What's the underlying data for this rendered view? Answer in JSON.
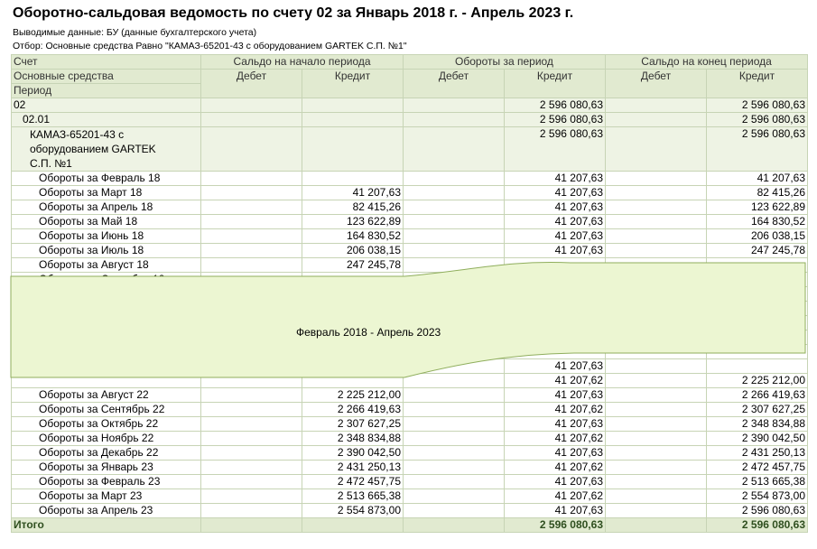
{
  "report": {
    "title": "Оборотно-сальдовая ведомость по счету 02 за Январь 2018 г. - Апрель 2023 г.",
    "output_data": "Выводимые данные: БУ (данные бухгалтерского учета)",
    "filter": "Отбор: Основные средства Равно \"КАМАЗ-65201-43 с оборудованием GARTEK С.П. №1\""
  },
  "table": {
    "col_account": "Счет",
    "col_fixed_assets": "Основные средства",
    "col_period": "Период",
    "group_start": "Сальдо на начало периода",
    "group_turnover": "Обороты за период",
    "group_end": "Сальдо на конец периода",
    "debit": "Дебет",
    "credit": "Кредит",
    "rows": [
      {
        "label": "02",
        "indent": 0,
        "kind": "grp",
        "sd": "",
        "sk": "",
        "od": "",
        "ok": "2 596 080,63",
        "ed": "",
        "ek": "2 596 080,63"
      },
      {
        "label": "02.01",
        "indent": 1,
        "kind": "grp",
        "sd": "",
        "sk": "",
        "od": "",
        "ok": "2 596 080,63",
        "ed": "",
        "ek": "2 596 080,63"
      },
      {
        "label": "КАМАЗ-65201-43 с оборудованием GARTEK С.П. №1",
        "indent": 2,
        "kind": "asset",
        "sd": "",
        "sk": "",
        "od": "",
        "ok": "2 596 080,63",
        "ed": "",
        "ek": "2 596 080,63"
      },
      {
        "label": "Обороты за Февраль 18",
        "indent": 3,
        "sd": "",
        "sk": "",
        "od": "",
        "ok": "41 207,63",
        "ed": "",
        "ek": "41 207,63"
      },
      {
        "label": "Обороты за Март 18",
        "indent": 3,
        "sd": "",
        "sk": "41 207,63",
        "od": "",
        "ok": "41 207,63",
        "ed": "",
        "ek": "82 415,26"
      },
      {
        "label": "Обороты за Апрель 18",
        "indent": 3,
        "sd": "",
        "sk": "82 415,26",
        "od": "",
        "ok": "41 207,63",
        "ed": "",
        "ek": "123 622,89"
      },
      {
        "label": "Обороты за Май 18",
        "indent": 3,
        "sd": "",
        "sk": "123 622,89",
        "od": "",
        "ok": "41 207,63",
        "ed": "",
        "ek": "164 830,52"
      },
      {
        "label": "Обороты за Июнь 18",
        "indent": 3,
        "sd": "",
        "sk": "164 830,52",
        "od": "",
        "ok": "41 207,63",
        "ed": "",
        "ek": "206 038,15"
      },
      {
        "label": "Обороты за Июль 18",
        "indent": 3,
        "sd": "",
        "sk": "206 038,15",
        "od": "",
        "ok": "41 207,63",
        "ed": "",
        "ek": "247 245,78"
      },
      {
        "label": "Обороты за Август 18",
        "indent": 3,
        "sd": "",
        "sk": "247 245,78",
        "od": "",
        "ok": "",
        "ed": "",
        "ek": ""
      },
      {
        "label": "Обороты за Сентябрь 18",
        "indent": 3,
        "sd": "",
        "sk": "",
        "od": "",
        "ok": "",
        "ed": "",
        "ek": ""
      },
      {
        "label": "",
        "indent": 3,
        "sd": "",
        "sk": "",
        "od": "",
        "ok": "",
        "ed": "",
        "ek": ""
      },
      {
        "label": "",
        "indent": 3,
        "sd": "",
        "sk": "",
        "od": "",
        "ok": "",
        "ed": "",
        "ek": ""
      },
      {
        "label": "",
        "indent": 3,
        "sd": "",
        "sk": "",
        "od": "",
        "ok": "",
        "ed": "",
        "ek": ""
      },
      {
        "label": "",
        "indent": 3,
        "sd": "",
        "sk": "",
        "od": "",
        "ok": "",
        "ed": "",
        "ek": ""
      },
      {
        "label": "",
        "indent": 3,
        "sd": "",
        "sk": "",
        "od": "",
        "ok": "",
        "ed": "",
        "ek": ""
      },
      {
        "label": "",
        "indent": 3,
        "sd": "",
        "sk": "",
        "od": "",
        "ok": "41 207,63",
        "ed": "",
        "ek": ""
      },
      {
        "label": "",
        "indent": 3,
        "sd": "",
        "sk": "",
        "od": "",
        "ok": "41 207,62",
        "ed": "",
        "ek": "2 225 212,00"
      },
      {
        "label": "Обороты за Август 22",
        "indent": 3,
        "sd": "",
        "sk": "2 225 212,00",
        "od": "",
        "ok": "41 207,63",
        "ed": "",
        "ek": "2 266 419,63"
      },
      {
        "label": "Обороты за Сентябрь 22",
        "indent": 3,
        "sd": "",
        "sk": "2 266 419,63",
        "od": "",
        "ok": "41 207,62",
        "ed": "",
        "ek": "2 307 627,25"
      },
      {
        "label": "Обороты за Октябрь 22",
        "indent": 3,
        "sd": "",
        "sk": "2 307 627,25",
        "od": "",
        "ok": "41 207,63",
        "ed": "",
        "ek": "2 348 834,88"
      },
      {
        "label": "Обороты за Ноябрь 22",
        "indent": 3,
        "sd": "",
        "sk": "2 348 834,88",
        "od": "",
        "ok": "41 207,62",
        "ed": "",
        "ek": "2 390 042,50"
      },
      {
        "label": "Обороты за Декабрь 22",
        "indent": 3,
        "sd": "",
        "sk": "2 390 042,50",
        "od": "",
        "ok": "41 207,63",
        "ed": "",
        "ek": "2 431 250,13"
      },
      {
        "label": "Обороты за Январь 23",
        "indent": 3,
        "sd": "",
        "sk": "2 431 250,13",
        "od": "",
        "ok": "41 207,62",
        "ed": "",
        "ek": "2 472 457,75"
      },
      {
        "label": "Обороты за Февраль 23",
        "indent": 3,
        "sd": "",
        "sk": "2 472 457,75",
        "od": "",
        "ok": "41 207,63",
        "ed": "",
        "ek": "2 513 665,38"
      },
      {
        "label": "Обороты за Март 23",
        "indent": 3,
        "sd": "",
        "sk": "2 513 665,38",
        "od": "",
        "ok": "41 207,62",
        "ed": "",
        "ek": "2 554 873,00"
      },
      {
        "label": "Обороты за Апрель 23",
        "indent": 3,
        "sd": "",
        "sk": "2 554 873,00",
        "od": "",
        "ok": "41 207,63",
        "ed": "",
        "ek": "2 596 080,63"
      }
    ],
    "total": {
      "label": "Итого",
      "sd": "",
      "sk": "",
      "od": "",
      "ok": "2 596 080,63",
      "ed": "",
      "ek": "2 596 080,63"
    }
  },
  "callout": {
    "text": "Февраль 2018 - Апрель 2023",
    "fill": "#ecf6d2",
    "stroke": "#8fae5c"
  }
}
